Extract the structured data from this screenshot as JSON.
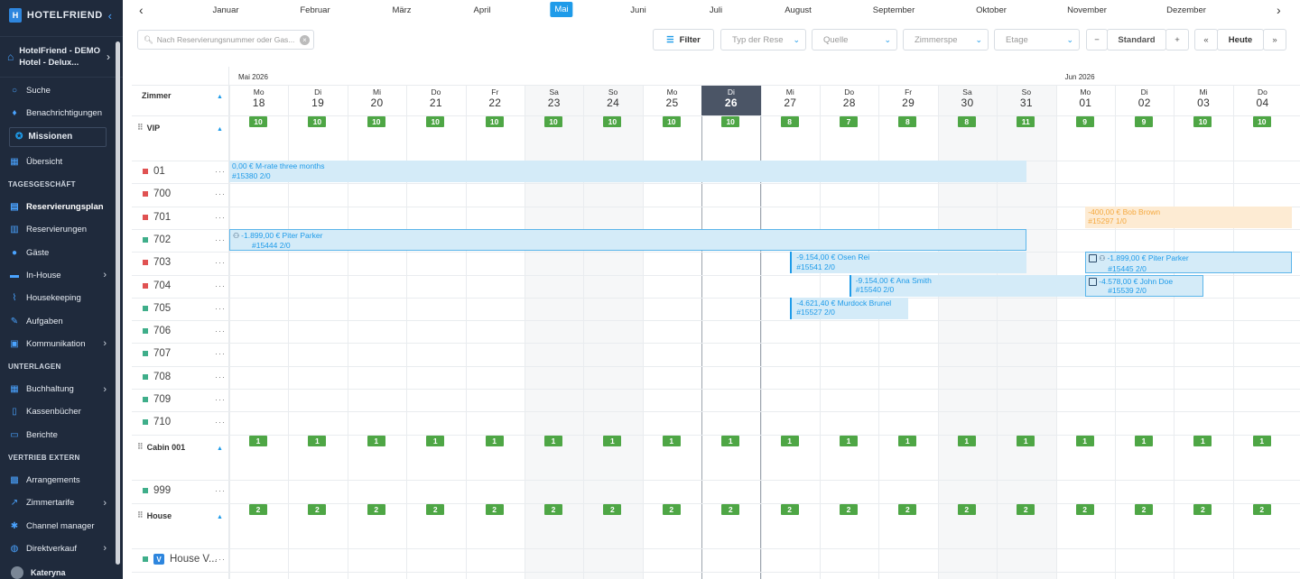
{
  "sidebar": {
    "brand": "HOTELFRIEND",
    "hotel_line1": "HotelFriend - DEMO",
    "hotel_line2": "Hotel - Delux...",
    "missionen": "Missionen",
    "items_top": [
      {
        "label": "Suche",
        "icon": "search-icon"
      },
      {
        "label": "Benachrichtigungen",
        "icon": "bell-icon"
      }
    ],
    "overview": "Übersicht",
    "section_tagesgeschaeft": "TAGESGESCHÄFT",
    "items_tages": [
      {
        "label": "Reservierungsplan",
        "icon": "calendar-icon"
      },
      {
        "label": "Reservierungen",
        "icon": "list-icon"
      },
      {
        "label": "Gäste",
        "icon": "user-icon"
      },
      {
        "label": "In-House",
        "icon": "bed-icon"
      },
      {
        "label": "Housekeeping",
        "icon": "broom-icon"
      },
      {
        "label": "Aufgaben",
        "icon": "wrench-icon"
      },
      {
        "label": "Kommunikation",
        "icon": "chat-icon"
      }
    ],
    "section_unterlagen": "UNTERLAGEN",
    "items_unterlagen": [
      {
        "label": "Buchhaltung",
        "icon": "ledger-icon"
      },
      {
        "label": "Kassenbücher",
        "icon": "book-icon"
      },
      {
        "label": "Berichte",
        "icon": "report-icon"
      }
    ],
    "section_vertrieb": "VERTRIEB EXTERN",
    "items_vertrieb": [
      {
        "label": "Arrangements",
        "icon": "package-icon"
      },
      {
        "label": "Zimmertarife",
        "icon": "chart-icon"
      },
      {
        "label": "Channel manager",
        "icon": "network-icon"
      },
      {
        "label": "Direktverkauf",
        "icon": "cart-icon"
      }
    ],
    "user": "Kateryna"
  },
  "months": [
    "Januar",
    "Februar",
    "März",
    "April",
    "Mai",
    "Juni",
    "Juli",
    "August",
    "September",
    "Oktober",
    "November",
    "Dezember"
  ],
  "active_month": "Mai",
  "toolbar": {
    "search_placeholder": "Nach Reservierungsnummer oder Gas...",
    "filter": "Filter",
    "select_type": "Typ der Rese",
    "select_source": "Quelle",
    "select_rooms": "Zimmerspe",
    "select_floor": "Etage",
    "zoom_label": "Standard",
    "today": "Heute",
    "zoom_out": "−",
    "zoom_in": "+",
    "prev": "«",
    "next": "»"
  },
  "grid": {
    "rooms_header": "Zimmer",
    "month_labels": [
      "Mai 2026",
      "Jun 2026"
    ],
    "days": [
      {
        "dn": "Mo",
        "dd": "18"
      },
      {
        "dn": "Di",
        "dd": "19"
      },
      {
        "dn": "Mi",
        "dd": "20"
      },
      {
        "dn": "Do",
        "dd": "21"
      },
      {
        "dn": "Fr",
        "dd": "22"
      },
      {
        "dn": "Sa",
        "dd": "23"
      },
      {
        "dn": "So",
        "dd": "24"
      },
      {
        "dn": "Mo",
        "dd": "25"
      },
      {
        "dn": "Di",
        "dd": "26"
      },
      {
        "dn": "Mi",
        "dd": "27"
      },
      {
        "dn": "Do",
        "dd": "28"
      },
      {
        "dn": "Fr",
        "dd": "29"
      },
      {
        "dn": "Sa",
        "dd": "30"
      },
      {
        "dn": "So",
        "dd": "31"
      },
      {
        "dn": "Mo",
        "dd": "01"
      },
      {
        "dn": "Di",
        "dd": "02"
      },
      {
        "dn": "Mi",
        "dd": "03"
      },
      {
        "dn": "Do",
        "dd": "04"
      }
    ],
    "groups": [
      {
        "name": "VIP",
        "counts": [
          "10",
          "10",
          "10",
          "10",
          "10",
          "10",
          "10",
          "10",
          "10",
          "8",
          "7",
          "8",
          "8",
          "11",
          "9",
          "9",
          "10",
          "10"
        ]
      },
      {
        "name": "Cabin 001",
        "counts": [
          "1",
          "1",
          "1",
          "1",
          "1",
          "1",
          "1",
          "1",
          "1",
          "1",
          "1",
          "1",
          "1",
          "1",
          "1",
          "1",
          "1",
          "1"
        ]
      },
      {
        "name": "House",
        "counts": [
          "2",
          "2",
          "2",
          "2",
          "2",
          "2",
          "2",
          "2",
          "2",
          "2",
          "2",
          "2",
          "2",
          "2",
          "2",
          "2",
          "2",
          "2"
        ]
      }
    ],
    "rooms": [
      {
        "name": "01",
        "status": "#e05252"
      },
      {
        "name": "700",
        "status": "#e05252"
      },
      {
        "name": "701",
        "status": "#e05252"
      },
      {
        "name": "702",
        "status": "#3fae8a"
      },
      {
        "name": "703",
        "status": "#e05252"
      },
      {
        "name": "704",
        "status": "#e05252"
      },
      {
        "name": "705",
        "status": "#3fae8a"
      },
      {
        "name": "706",
        "status": "#3fae8a"
      },
      {
        "name": "707",
        "status": "#3fae8a"
      },
      {
        "name": "708",
        "status": "#3fae8a"
      },
      {
        "name": "709",
        "status": "#3fae8a"
      },
      {
        "name": "710",
        "status": "#3fae8a"
      }
    ],
    "cabin_room": "999",
    "house_room": "House V...",
    "house_badge": "V"
  },
  "reservations": [
    {
      "line1": "0,00 € M-rate three months",
      "line2": "#15380 2/0"
    },
    {
      "line1": "-400,00 € Bob Brown",
      "line2": "#15297 1/0"
    },
    {
      "line1": "-1.899,00 € Piter Parker",
      "line2": "#15444 2/0"
    },
    {
      "line1": "-9.154,00 € Osen Rei",
      "line2": "#15541 2/0"
    },
    {
      "line1": "-1.899,00 € Piter Parker",
      "line2": "#15445 2/0"
    },
    {
      "line1": "-9.154,00 € Ana Smith",
      "line2": "#15540 2/0"
    },
    {
      "line1": "-4.578,00 € John Doe",
      "line2": "#15539 2/0"
    },
    {
      "line1": "-4.621,40 € Murdock Brunel",
      "line2": "#15527 2/0"
    }
  ],
  "colors": {
    "accent": "#1e9be9",
    "sidebar_bg": "#1f2a3c",
    "count_green": "#4ea645",
    "today_header": "#4b5566"
  }
}
